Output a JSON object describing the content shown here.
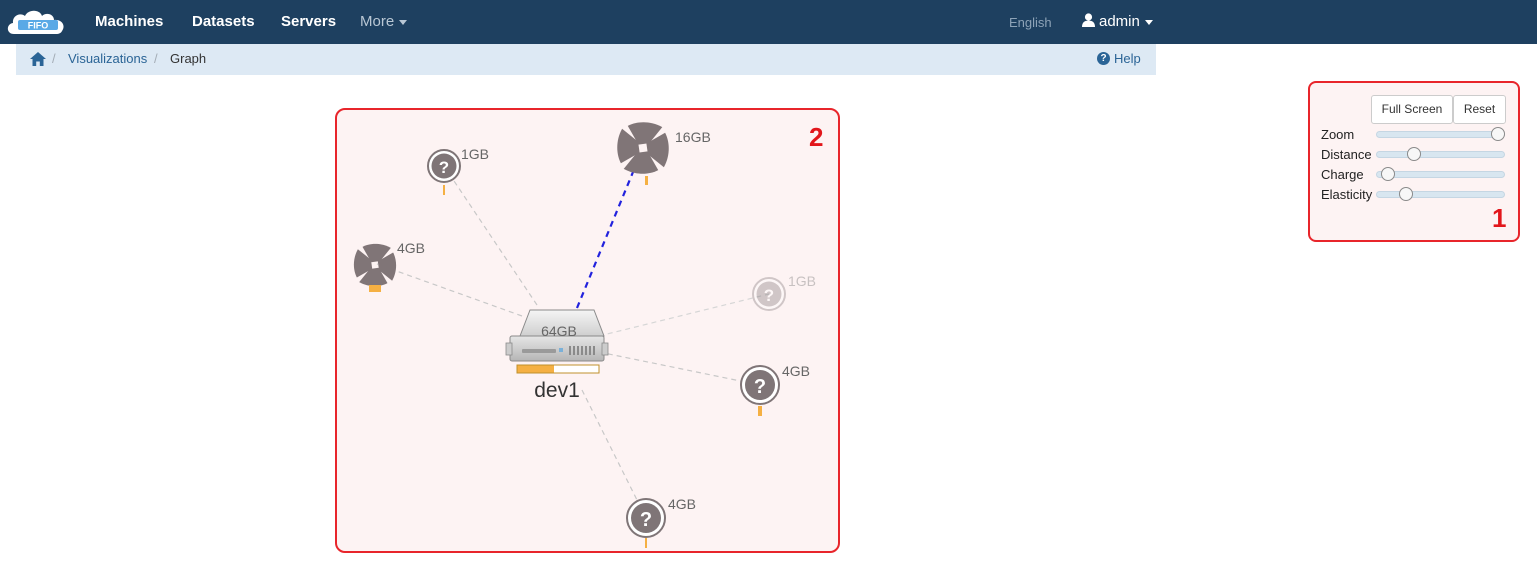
{
  "navbar": {
    "logo_text": "FIFO",
    "items": [
      "Machines",
      "Datasets",
      "Servers"
    ],
    "more_label": "More",
    "language": "English",
    "user": "admin"
  },
  "breadcrumb": {
    "home_icon": "home-icon",
    "items": [
      "Visualizations",
      "Graph"
    ],
    "help_label": "Help"
  },
  "graph": {
    "marker": "2",
    "center": {
      "label": "dev1",
      "size": "64GB",
      "usage_fraction": 0.45
    },
    "nodes": [
      {
        "type": "unknown",
        "size": "1GB"
      },
      {
        "type": "dataset",
        "size": "16GB"
      },
      {
        "type": "dataset",
        "size": "4GB"
      },
      {
        "type": "unknown",
        "size": "1GB",
        "faded": true
      },
      {
        "type": "unknown",
        "size": "4GB"
      },
      {
        "type": "unknown",
        "size": "4GB"
      }
    ],
    "colors": {
      "link": "#cccccc",
      "active_link": "#2222dd",
      "usage": "#f5b043",
      "node": "#7f7577"
    }
  },
  "controls": {
    "marker": "1",
    "fullscreen_label": "Full Screen",
    "reset_label": "Reset",
    "sliders": [
      {
        "label": "Zoom",
        "value": 0.95
      },
      {
        "label": "Distance",
        "value": 0.29
      },
      {
        "label": "Charge",
        "value": 0.09
      },
      {
        "label": "Elasticity",
        "value": 0.23
      }
    ]
  }
}
